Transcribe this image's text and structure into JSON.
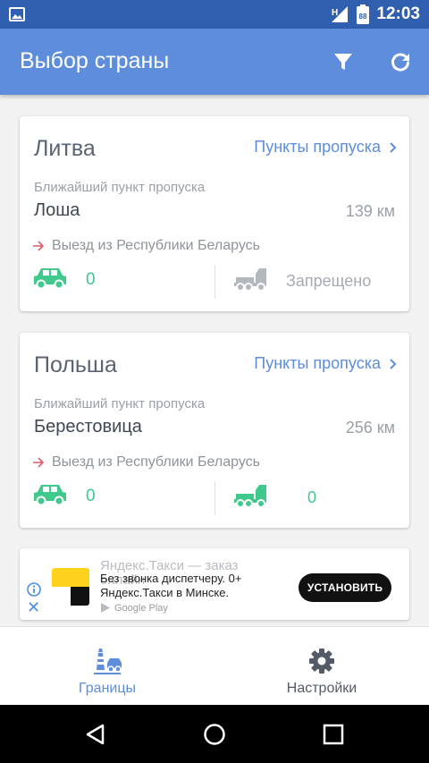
{
  "status_bar": {
    "time": "12:03",
    "network": "H",
    "battery": "88"
  },
  "app_bar": {
    "title": "Выбор страны",
    "icons": [
      "filter-icon",
      "refresh-icon"
    ]
  },
  "cards": [
    {
      "country": "Литва",
      "link": "Пункты пропуска",
      "nearest_label": "Ближайший пункт пропуска",
      "point": "Лоша",
      "distance": "139 км",
      "direction": "Выезд из Республики Беларусь",
      "cars": "0",
      "trucks": "Запрещено"
    },
    {
      "country": "Польша",
      "link": "Пункты пропуска",
      "nearest_label": "Ближайший пункт пропуска",
      "point": "Берестовица",
      "distance": "256 км",
      "direction": "Выезд из Республики Беларусь",
      "cars": "0",
      "trucks": "0"
    }
  ],
  "ad": {
    "headline": "Яндекс.Такси — заказ онлайн",
    "description": "Без звонка диспетчеру. 0+ Яндекс.Такси в Минске.",
    "store": "Google Play",
    "button": "УСТАНОВИТЬ"
  },
  "bottom_nav": {
    "tabs": [
      {
        "label": "Границы",
        "icon": "border-lighthouse-icon",
        "active": true
      },
      {
        "label": "Настройки",
        "icon": "gear-icon",
        "active": false
      }
    ]
  },
  "colors": {
    "accent": "#5d8ddb",
    "status_bar": "#2f5fae",
    "green": "#3fc98c",
    "exit_arrow": "#e05a6a"
  }
}
